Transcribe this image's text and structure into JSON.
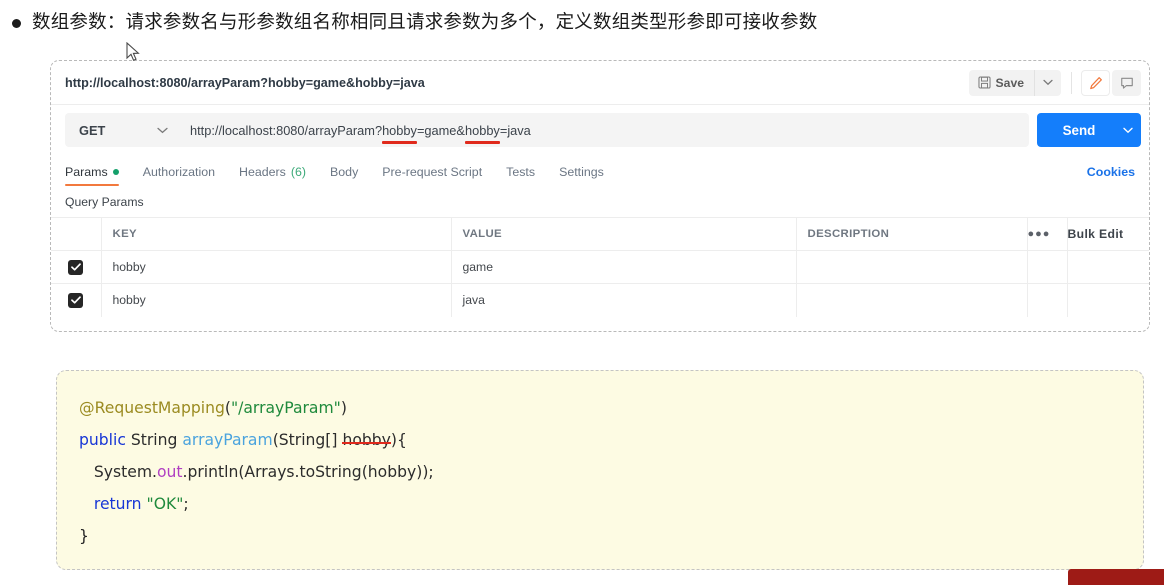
{
  "heading": {
    "bullet": "●",
    "text": "数组参数：请求参数名与形参数组名称相同且请求参数为多个，定义数组类型形参即可接收参数"
  },
  "postman": {
    "request_title": "http://localhost:8080/arrayParam?hobby=game&hobby=java",
    "save_label": "Save",
    "method": "GET",
    "url": {
      "prefix": "http://localhost:8080/arrayParam?",
      "param1_key": "hobby",
      "eq1": "=game&",
      "param2_key": "hobby",
      "eq2": "=java"
    },
    "send_label": "Send",
    "tabs": [
      {
        "label": "Params",
        "active": true,
        "dot": true
      },
      {
        "label": "Authorization",
        "active": false
      },
      {
        "label": "Headers",
        "count": "(6)",
        "active": false
      },
      {
        "label": "Body",
        "active": false
      },
      {
        "label": "Pre-request Script",
        "active": false
      },
      {
        "label": "Tests",
        "active": false
      },
      {
        "label": "Settings",
        "active": false
      }
    ],
    "cookies_label": "Cookies",
    "query_params_label": "Query Params",
    "table": {
      "headers": [
        "KEY",
        "VALUE",
        "DESCRIPTION"
      ],
      "dots_label": "●●●",
      "bulk_edit_label": "Bulk Edit",
      "rows": [
        {
          "checked": true,
          "key": "hobby",
          "value": "game",
          "description": ""
        },
        {
          "checked": true,
          "key": "hobby",
          "value": "java",
          "description": ""
        }
      ]
    }
  },
  "code": {
    "line1": {
      "anno": "@RequestMapping",
      "paren_open": "(",
      "str": "\"/arrayParam\"",
      "paren_close": ")"
    },
    "line2": {
      "kw": "public",
      "type": " String ",
      "fn": "arrayParam",
      "args_pre": "(String[] ",
      "param": "hobby",
      "args_post": "){"
    },
    "line3": {
      "a": "   System.",
      "field": "out",
      "b": ".println(Arrays.toString(hobby));"
    },
    "line4": {
      "kw": "   return ",
      "str": "\"OK\"",
      "semi": ";"
    },
    "line5": "}"
  },
  "colors": {
    "accent_blue": "#147efb",
    "tab_orange": "#f2793d",
    "link_blue": "#1a72e8",
    "underline_red": "#e02a1c",
    "code_bg": "#fdfbe3",
    "badge_red": "#9e1b16"
  }
}
